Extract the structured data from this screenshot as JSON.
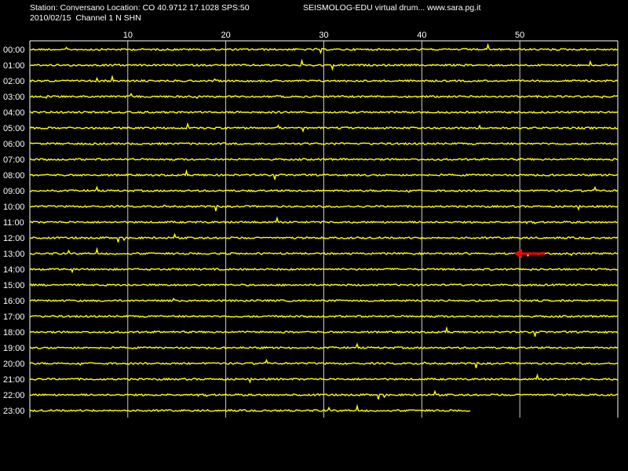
{
  "header": {
    "station_line": "Station: Conversano Location: CO 40.9712 17.1028 SPS:50",
    "title_line": "SEISMOLOG-EDU virtual drum... www.sara.pg.it",
    "date_line": "2010/02/15  Channel 1 N SHN"
  },
  "drum": {
    "minute_ticks": [
      "10",
      "20",
      "30",
      "40",
      "50"
    ],
    "hour_labels": [
      "00:00",
      "01:00",
      "02:00",
      "03:00",
      "04:00",
      "05:00",
      "06:00",
      "07:00",
      "08:00",
      "09:00",
      "10:00",
      "11:00",
      "12:00",
      "13:00",
      "14:00",
      "15:00",
      "16:00",
      "17:00",
      "18:00",
      "19:00",
      "20:00",
      "21:00",
      "22:00",
      "23:00"
    ],
    "minutes_per_row": 60,
    "last_row_end_minute": 45,
    "trace_color": "#ffff00",
    "grid_color": "#ffffff",
    "marker": {
      "row": 13,
      "minute": 49.5,
      "color": "#ff0000",
      "icon": "left-arrow-icon"
    }
  }
}
